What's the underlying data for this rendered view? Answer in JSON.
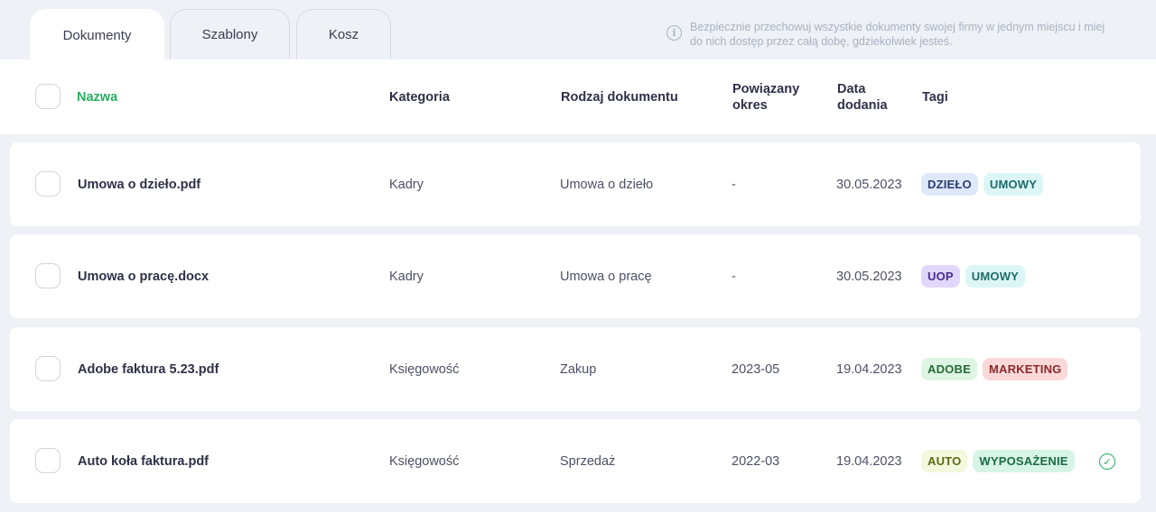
{
  "tabs": [
    {
      "label": "Dokumenty",
      "active": true
    },
    {
      "label": "Szablony",
      "active": false
    },
    {
      "label": "Kosz",
      "active": false
    }
  ],
  "info": {
    "line1": "Bezpiecznie przechowuj wszystkie dokumenty swojej firmy w jednym miejscu i miej",
    "line2": "do nich dostęp przez całą dobę, gdziekolwiek jesteś.",
    "icon": "info-icon"
  },
  "columns": {
    "name": "Nazwa",
    "category": "Kategoria",
    "doc_type": "Rodzaj dokumentu",
    "period_line1": "Powiązany",
    "period_line2": "okres",
    "date_line1": "Data",
    "date_line2": "dodania",
    "tags": "Tagi"
  },
  "accent_color": "#27ae60",
  "rows": [
    {
      "name": "Umowa o dzieło.pdf",
      "category": "Kadry",
      "doc_type": "Umowa o dzieło",
      "period": "-",
      "date": "30.05.2023",
      "tags": [
        {
          "label": "DZIEŁO",
          "bg": "#dde8fb",
          "fg": "#2c3d6e"
        },
        {
          "label": "UMOWY",
          "bg": "#dcf6f6",
          "fg": "#1f6b6b"
        }
      ],
      "status_icon": ""
    },
    {
      "name": "Umowa o pracę.docx",
      "category": "Kadry",
      "doc_type": "Umowa o pracę",
      "period": "-",
      "date": "30.05.2023",
      "tags": [
        {
          "label": "UOP",
          "bg": "#e1d7fb",
          "fg": "#4a2d8f"
        },
        {
          "label": "UMOWY",
          "bg": "#dcf6f6",
          "fg": "#1f6b6b"
        }
      ],
      "status_icon": ""
    },
    {
      "name": "Adobe faktura 5.23.pdf",
      "category": "Księgowość",
      "doc_type": "Zakup",
      "period": "2023-05",
      "date": "19.04.2023",
      "tags": [
        {
          "label": "ADOBE",
          "bg": "#dff5e3",
          "fg": "#256b35"
        },
        {
          "label": "MARKETING",
          "bg": "#fbd9d9",
          "fg": "#8a2a2a"
        }
      ],
      "status_icon": ""
    },
    {
      "name": "Auto koła faktura.pdf",
      "category": "Księgowość",
      "doc_type": "Sprzedaż",
      "period": "2022-03",
      "date": "19.04.2023",
      "tags": [
        {
          "label": "AUTO",
          "bg": "#f3f9dc",
          "fg": "#5a6a12"
        },
        {
          "label": "WYPOSAŻENIE",
          "bg": "#d6f5e6",
          "fg": "#1d6a45"
        }
      ],
      "status_icon": "check-circle-icon"
    }
  ]
}
